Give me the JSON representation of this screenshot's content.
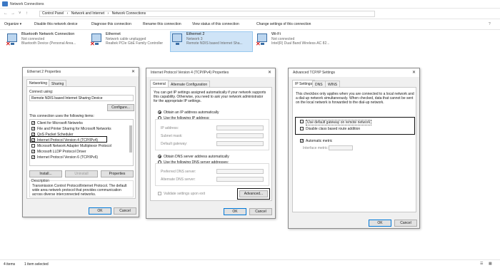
{
  "window": {
    "title": "Network Connections"
  },
  "address": {
    "crumbs": [
      "Control Panel",
      "Network and Internet",
      "Network Connections"
    ]
  },
  "commands": [
    "Organize ▾",
    "Disable this network device",
    "Diagnose this connection",
    "Rename this connection",
    "View status of this connection",
    "Change settings of this connection"
  ],
  "connections": [
    {
      "name": "Bluetooth Network Connection",
      "status": "Not connected",
      "device": "Bluetooth Device (Personal Area...",
      "selected": false
    },
    {
      "name": "Ethernet",
      "status": "Network cable unplugged",
      "device": "Realtek PCIe GbE Family Controller",
      "selected": false
    },
    {
      "name": "Ethernet 2",
      "status": "Network 3",
      "device": "Remote NDIS based Internet Sha...",
      "selected": true
    },
    {
      "name": "Wi-Fi",
      "status": "Not connected",
      "device": "Intel(R) Dual Band Wireless-AC 82...",
      "selected": false
    }
  ],
  "dlg1": {
    "title": "Ethernet 2 Properties",
    "tabs": [
      "Networking",
      "Sharing"
    ],
    "connect_using_label": "Connect using:",
    "adapter": "Remote NDIS based Internet Sharing Device",
    "configure": "Configure...",
    "items_label": "This connection uses the following items:",
    "items": [
      {
        "label": "Client for Microsoft Networks",
        "checked": true
      },
      {
        "label": "File and Printer Sharing for Microsoft Networks",
        "checked": true
      },
      {
        "label": "QoS Packet Scheduler",
        "checked": true
      },
      {
        "label": "Internet Protocol Version 4 (TCP/IPv4)",
        "checked": true
      },
      {
        "label": "Microsoft Network Adapter Multiplexor Protocol",
        "checked": false
      },
      {
        "label": "Microsoft LLDP Protocol Driver",
        "checked": true
      },
      {
        "label": "Internet Protocol Version 6 (TCP/IPv6)",
        "checked": true
      }
    ],
    "install": "Install...",
    "uninstall": "Uninstall",
    "properties": "Properties",
    "description_label": "Description",
    "description": "Transmission Control Protocol/Internet Protocol. The default wide area network protocol that provides communication across diverse interconnected networks.",
    "ok": "OK",
    "cancel": "Cancel"
  },
  "dlg2": {
    "title": "Internet Protocol Version 4 (TCP/IPv4) Properties",
    "tabs": [
      "General",
      "Alternate Configuration"
    ],
    "intro": "You can get IP settings assigned automatically if your network supports this capability. Otherwise, you need to ask your network administrator for the appropriate IP settings.",
    "obtain_ip": "Obtain an IP address automatically",
    "use_ip": "Use the following IP address:",
    "ip_label": "IP address:",
    "subnet_label": "Subnet mask:",
    "gateway_label": "Default gateway:",
    "obtain_dns": "Obtain DNS server address automatically",
    "use_dns": "Use the following DNS server addresses:",
    "pref_dns": "Preferred DNS server:",
    "alt_dns": "Alternate DNS server:",
    "validate": "Validate settings upon exit",
    "advanced": "Advanced...",
    "ok": "OK",
    "cancel": "Cancel"
  },
  "dlg3": {
    "title": "Advanced TCP/IP Settings",
    "tabs": [
      "IP Settings",
      "DNS",
      "WINS"
    ],
    "text": "This checkbox only applies when you are connected to a local network and a dial-up network simultaneously. When checked, data that cannot be sent on the local network is forwarded to the dial-up network.",
    "use_gateway": "Use default gateway on remote network",
    "disable_class": "Disable class based route addition",
    "auto_metric": "Automatic metric",
    "iface_metric": "Interface metric:",
    "ok": "OK",
    "cancel": "Cancel"
  },
  "status": {
    "items": "4 items",
    "selected": "1 item selected"
  }
}
